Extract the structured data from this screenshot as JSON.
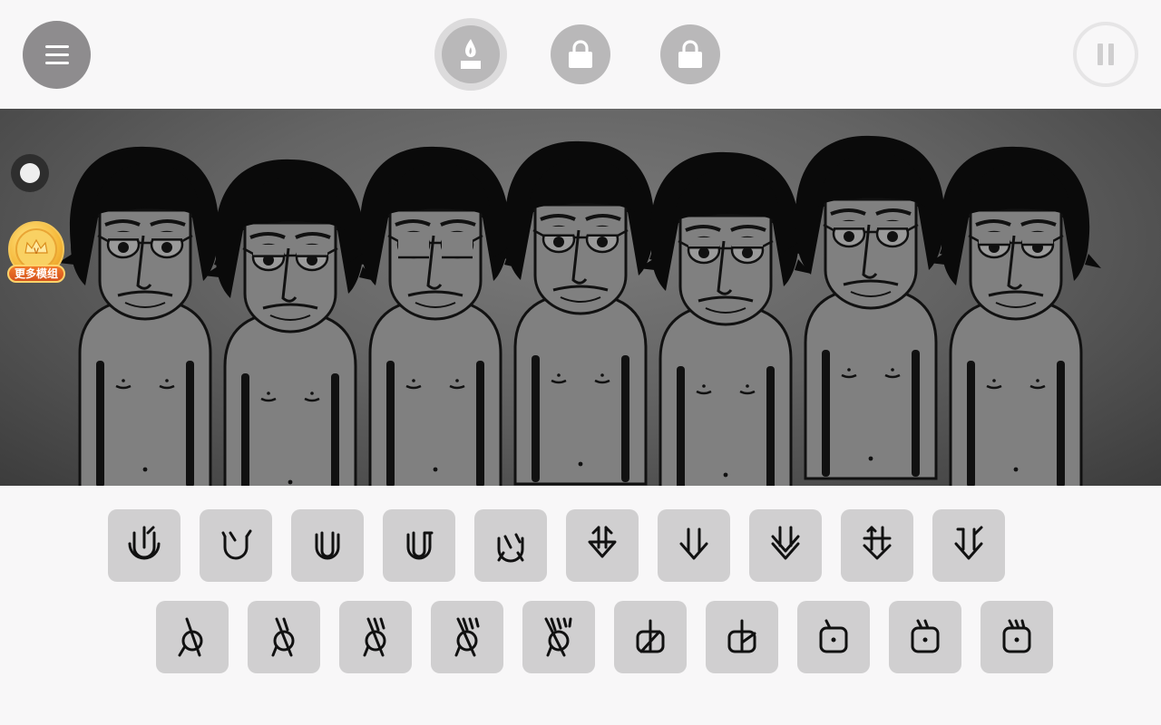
{
  "topbar": {
    "menu_icon": "hamburger-icon",
    "modes": [
      {
        "name": "candle-mode",
        "icon": "candle-icon",
        "state": "unlocked-selected"
      },
      {
        "name": "locked-mode-2",
        "icon": "lock-icon",
        "state": "locked"
      },
      {
        "name": "locked-mode-3",
        "icon": "lock-icon",
        "state": "locked"
      }
    ],
    "pause_icon": "pause-icon"
  },
  "stage": {
    "character_count": 7,
    "record_icon": "record-icon",
    "more_mods_label": "更多模组"
  },
  "sound_pads": {
    "row1": [
      "beat-1",
      "beat-2",
      "beat-3",
      "beat-4",
      "beat-5",
      "effect-1",
      "effect-2",
      "effect-3",
      "effect-4",
      "effect-5"
    ],
    "row2": [
      "melody-1",
      "melody-2",
      "melody-3",
      "melody-4",
      "melody-5",
      "voice-1",
      "voice-2",
      "voice-3",
      "voice-4",
      "voice-5"
    ]
  },
  "colors": {
    "background": "#f8f7f8",
    "pad": "#d0cfd0",
    "stage_center": "#7a7a7a",
    "stage_edge": "#3c3c3c",
    "character_fill": "#808080",
    "badge_gold": "#f6b93a",
    "badge_orange": "#e0621f"
  }
}
